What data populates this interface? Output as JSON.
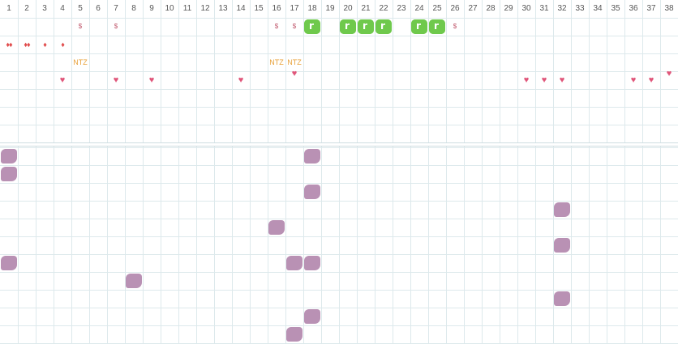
{
  "days": [
    "1",
    "2",
    "3",
    "4",
    "5",
    "6",
    "7",
    "8",
    "9",
    "10",
    "11",
    "12",
    "13",
    "14",
    "15",
    "16",
    "17",
    "18",
    "19",
    "20",
    "21",
    "22",
    "23",
    "24",
    "25",
    "26",
    "27",
    "28",
    "29",
    "30",
    "31",
    "32",
    "33",
    "34",
    "35",
    "36",
    "37",
    "38"
  ],
  "colors": {
    "grid": "#dde9ec",
    "green": "#6fc94c",
    "purple": "#b58bb0",
    "heart": "#e0567a",
    "ntz": "#e8a13a",
    "dollar": "#c0586c",
    "drop": "#e04b4b"
  },
  "symbols": {
    "dollar": "$",
    "ntz": "NTZ",
    "heart": "♥",
    "drops_double": "♦♦",
    "drops_single": "♦"
  },
  "top_section": {
    "drops": [
      {
        "day": 1,
        "glyph": "♦♦",
        "name": "blood-drops-icon"
      },
      {
        "day": 2,
        "glyph": "♦♦",
        "name": "blood-drops-icon"
      },
      {
        "day": 3,
        "glyph": "♦",
        "name": "blood-drop-icon"
      },
      {
        "day": 4,
        "glyph": "♦",
        "name": "blood-drop-icon"
      }
    ],
    "dollar_days": [
      5,
      7,
      16,
      17,
      26
    ],
    "green_days": [
      18,
      20,
      21,
      22,
      24,
      25
    ],
    "ntz_days": [
      5,
      16,
      17
    ],
    "heart_days": [
      4,
      7,
      9,
      14,
      17,
      30,
      31,
      32,
      36,
      37,
      38
    ]
  },
  "bottom_section": {
    "blobs": [
      {
        "day": 1,
        "row": 0
      },
      {
        "day": 18,
        "row": 0
      },
      {
        "day": 1,
        "row": 1
      },
      {
        "day": 18,
        "row": 2
      },
      {
        "day": 32,
        "row": 3
      },
      {
        "day": 16,
        "row": 4
      },
      {
        "day": 32,
        "row": 5
      },
      {
        "day": 1,
        "row": 6
      },
      {
        "day": 17,
        "row": 6
      },
      {
        "day": 18,
        "row": 6
      },
      {
        "day": 8,
        "row": 7
      },
      {
        "day": 32,
        "row": 8
      },
      {
        "day": 18,
        "row": 9
      },
      {
        "day": 17,
        "row": 10
      }
    ]
  }
}
